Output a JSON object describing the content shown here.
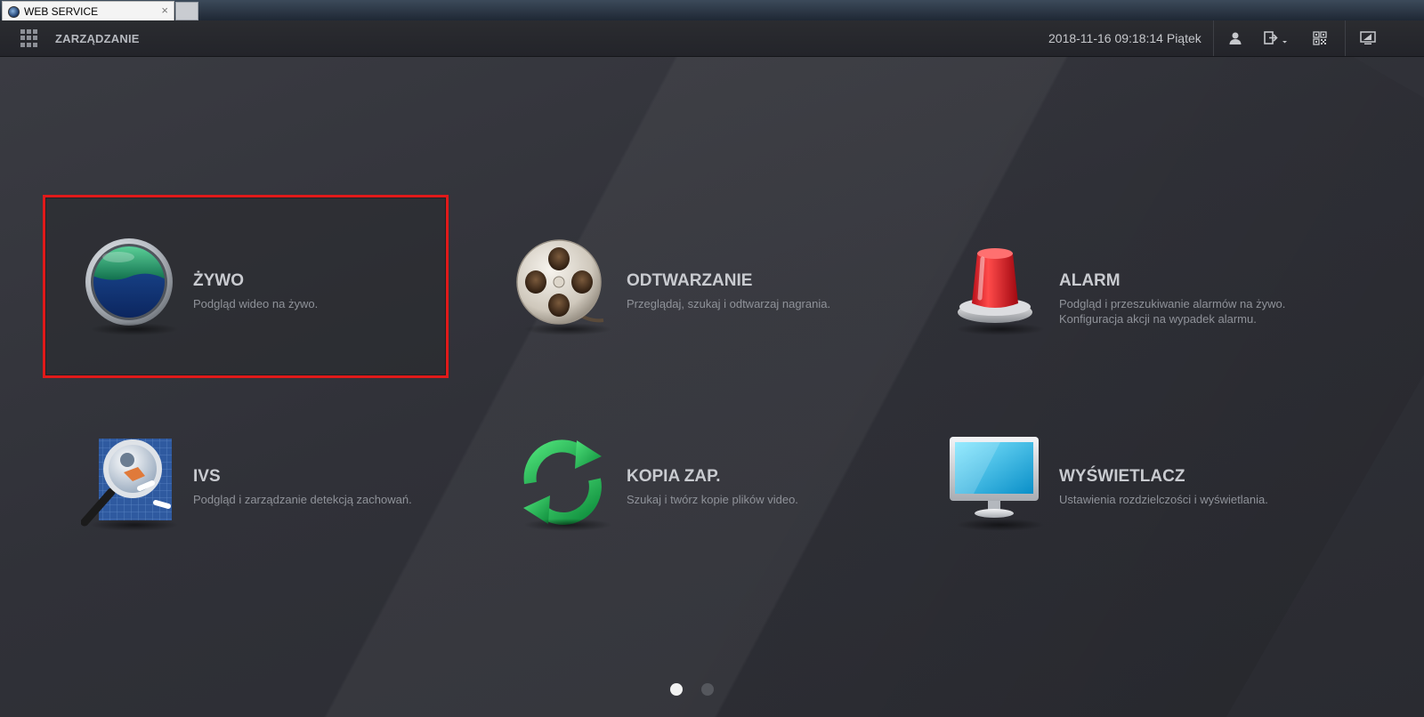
{
  "browser": {
    "tab_title": "WEB SERVICE",
    "tab_close": "×"
  },
  "header": {
    "menu_icon": "grid-icon",
    "title": "ZARZĄDZANIE",
    "datetime": "2018-11-16 09:18:14 Piątek",
    "icons": [
      "user-icon",
      "logout-icon",
      "qr-code-icon",
      "display-icon"
    ]
  },
  "tiles": [
    {
      "title": "ŻYWO",
      "desc": "Podgląd wideo na żywo.",
      "icon": "live-lens-icon",
      "selected": true
    },
    {
      "title": "ODTWARZANIE",
      "desc": "Przeglądaj, szukaj i odtwarzaj nagrania.",
      "icon": "film-reel-icon"
    },
    {
      "title": "ALARM",
      "desc": "Podgląd i przeszukiwanie alarmów na żywo.",
      "desc2": "Konfiguracja akcji na wypadek alarmu.",
      "icon": "alarm-siren-icon"
    },
    {
      "title": "IVS",
      "desc": "Podgląd i zarządzanie detekcją zachowań.",
      "icon": "magnifier-icon"
    },
    {
      "title": "KOPIA ZAP.",
      "desc": "Szukaj i twórz kopie plików video.",
      "icon": "refresh-arrows-icon"
    },
    {
      "title": "WYŚWIETLACZ",
      "desc": "Ustawienia rozdzielczości i wyświetlania.",
      "icon": "monitor-icon"
    }
  ],
  "pagination": {
    "pages": 2,
    "current": 1
  },
  "colors": {
    "selection": "#e01a1a",
    "background": "#2f3037",
    "title": "#c9cbd0",
    "desc": "#8f9299"
  }
}
